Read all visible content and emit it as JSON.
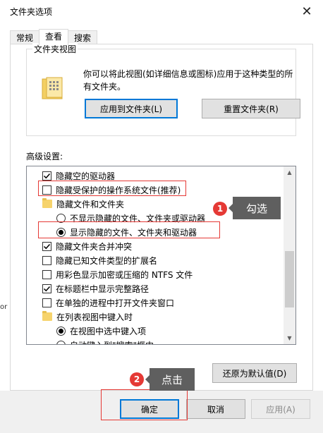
{
  "window": {
    "title": "文件夹选项",
    "close_glyph": "✕"
  },
  "left_stub": "or",
  "tabs": [
    {
      "label": "常规",
      "active": false
    },
    {
      "label": "查看",
      "active": true
    },
    {
      "label": "搜索",
      "active": false
    }
  ],
  "folder_view": {
    "label": "文件夹视图",
    "description": "你可以将此视图(如详细信息或图标)应用于这种类型的所有文件夹。",
    "apply_button": "应用到文件夹(L)",
    "reset_button": "重置文件夹(R)"
  },
  "advanced": {
    "label": "高级设置:",
    "items": [
      {
        "type": "checkbox",
        "checked": true,
        "label": "隐藏空的驱动器",
        "indent": 0
      },
      {
        "type": "checkbox",
        "checked": false,
        "label": "隐藏受保护的操作系统文件(推荐)",
        "indent": 0
      },
      {
        "type": "folder",
        "label": "隐藏文件和文件夹",
        "indent": 0
      },
      {
        "type": "radio",
        "checked": false,
        "label": "不显示隐藏的文件、文件夹或驱动器",
        "indent": 1
      },
      {
        "type": "radio",
        "checked": true,
        "label": "显示隐藏的文件、文件夹和驱动器",
        "indent": 1
      },
      {
        "type": "checkbox",
        "checked": true,
        "label": "隐藏文件夹合并冲突",
        "indent": 0
      },
      {
        "type": "checkbox",
        "checked": false,
        "label": "隐藏已知文件类型的扩展名",
        "indent": 0
      },
      {
        "type": "checkbox",
        "checked": false,
        "label": "用彩色显示加密或压缩的 NTFS 文件",
        "indent": 0
      },
      {
        "type": "checkbox",
        "checked": true,
        "label": "在标题栏中显示完整路径",
        "indent": 0
      },
      {
        "type": "checkbox",
        "checked": false,
        "label": "在单独的进程中打开文件夹窗口",
        "indent": 0
      },
      {
        "type": "folder",
        "label": "在列表视图中键入时",
        "indent": 0
      },
      {
        "type": "radio",
        "checked": true,
        "label": "在视图中选中键入项",
        "indent": 1
      },
      {
        "type": "radio",
        "checked": false,
        "label": "自动键入到\"搜索\"框中",
        "indent": 1
      }
    ],
    "restore_button": "还原为默认值(D)"
  },
  "footer": {
    "ok": "确定",
    "cancel": "取消",
    "apply": "应用(A)"
  },
  "annotations": {
    "step1": {
      "number": "1",
      "text": "勾选"
    },
    "step2": {
      "number": "2",
      "text": "点击"
    },
    "highlight_color": "#e53935",
    "callout_color": "#5f5f5f"
  },
  "colors": {
    "focus_border": "#0078d7",
    "folder": "#f6d36c"
  }
}
